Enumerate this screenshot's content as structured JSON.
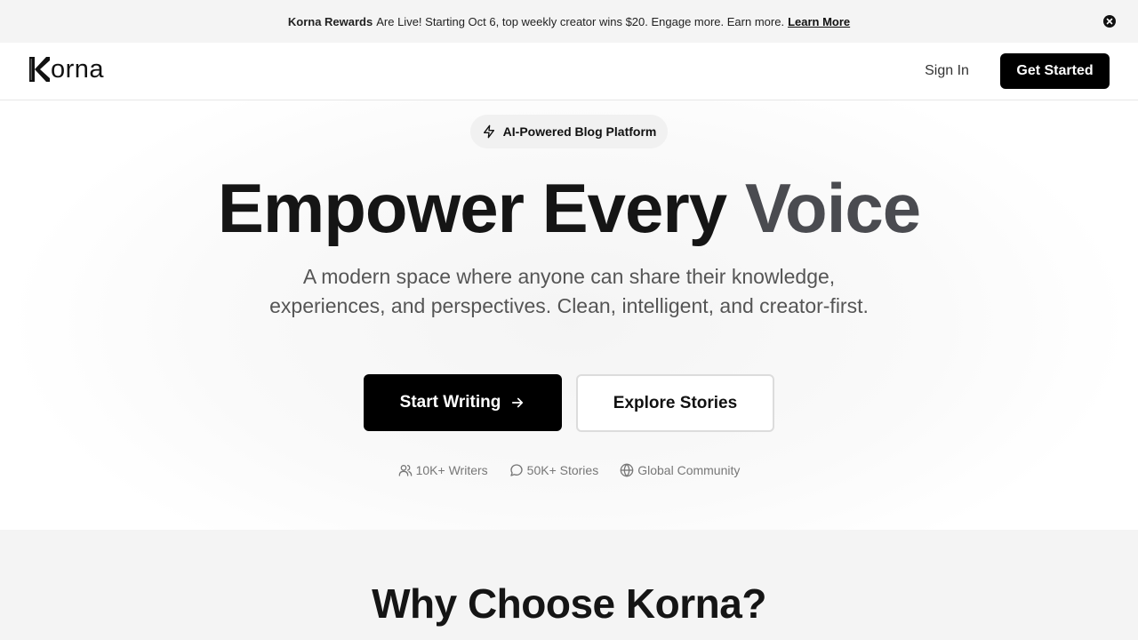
{
  "announcement": {
    "brand": "Korna Rewards",
    "message": "Are Live! Starting Oct 6, top weekly creator wins $20. Engage more. Earn more.",
    "link": "Learn More"
  },
  "header": {
    "logo_text": "orna",
    "sign_in": "Sign In",
    "get_started": "Get Started"
  },
  "hero": {
    "badge": "AI-Powered Blog Platform",
    "headline_main": "Empower Every",
    "headline_accent": "Voice",
    "subtitle": "A modern space where anyone can share their knowledge, experiences, and perspectives. Clean, intelligent, and creator-first.",
    "primary_cta": "Start Writing",
    "secondary_cta": "Explore Stories",
    "stats": [
      {
        "icon": "users-icon",
        "label": "10K+ Writers"
      },
      {
        "icon": "message-circle-icon",
        "label": "50K+ Stories"
      },
      {
        "icon": "globe-icon",
        "label": "Global Community"
      }
    ]
  },
  "features": {
    "title": "Why Choose Korna?"
  },
  "colors": {
    "primary": "#000000",
    "accent_text": "#4a4b50",
    "muted": "#777777",
    "section_bg": "#f4f4f4"
  }
}
